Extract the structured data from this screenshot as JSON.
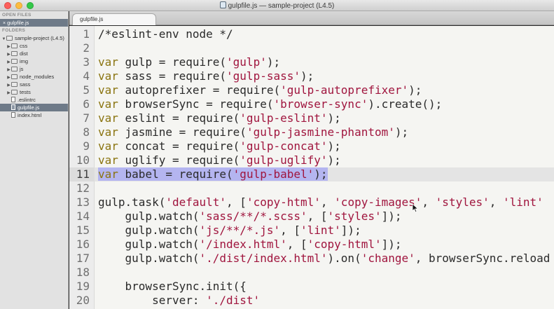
{
  "window": {
    "title": "gulpfile.js — sample-project (L4.5)"
  },
  "sidebar": {
    "open_files_header": "OPEN FILES",
    "open_files": [
      {
        "close": "×",
        "name": "gulpfile.js"
      }
    ],
    "folders_header": "FOLDERS",
    "tree": [
      {
        "arrow": "▼",
        "kind": "folder",
        "label": "sample-project (L4.5)",
        "depth": 0,
        "selected": false
      },
      {
        "arrow": "▶",
        "kind": "folder",
        "label": "css",
        "depth": 1,
        "selected": false
      },
      {
        "arrow": "▶",
        "kind": "folder",
        "label": "dist",
        "depth": 1,
        "selected": false
      },
      {
        "arrow": "▶",
        "kind": "folder",
        "label": "img",
        "depth": 1,
        "selected": false
      },
      {
        "arrow": "▶",
        "kind": "folder",
        "label": "js",
        "depth": 1,
        "selected": false
      },
      {
        "arrow": "▶",
        "kind": "folder",
        "label": "node_modules",
        "depth": 1,
        "selected": false
      },
      {
        "arrow": "▶",
        "kind": "folder",
        "label": "sass",
        "depth": 1,
        "selected": false
      },
      {
        "arrow": "▶",
        "kind": "folder",
        "label": "tests",
        "depth": 1,
        "selected": false
      },
      {
        "arrow": "",
        "kind": "file",
        "label": ".eslintrc",
        "depth": 1,
        "selected": false
      },
      {
        "arrow": "",
        "kind": "file",
        "label": "gulpfile.js",
        "depth": 1,
        "selected": true
      },
      {
        "arrow": "",
        "kind": "file",
        "label": "index.html",
        "depth": 1,
        "selected": false
      }
    ]
  },
  "tabs": [
    {
      "label": "gulpfile.js"
    }
  ],
  "editor": {
    "current_line": 11,
    "selected_line": 11,
    "lines": [
      {
        "n": "1",
        "tokens": [
          [
            "cm",
            "/*eslint-env node */"
          ]
        ]
      },
      {
        "n": "2",
        "tokens": []
      },
      {
        "n": "3",
        "tokens": [
          [
            "kw",
            "var"
          ],
          [
            "plain",
            " gulp = require("
          ],
          [
            "str",
            "'gulp'"
          ],
          [
            "plain",
            ");"
          ]
        ]
      },
      {
        "n": "4",
        "tokens": [
          [
            "kw",
            "var"
          ],
          [
            "plain",
            " sass = require("
          ],
          [
            "str",
            "'gulp-sass'"
          ],
          [
            "plain",
            ");"
          ]
        ]
      },
      {
        "n": "5",
        "tokens": [
          [
            "kw",
            "var"
          ],
          [
            "plain",
            " autoprefixer = require("
          ],
          [
            "str",
            "'gulp-autoprefixer'"
          ],
          [
            "plain",
            ");"
          ]
        ]
      },
      {
        "n": "6",
        "tokens": [
          [
            "kw",
            "var"
          ],
          [
            "plain",
            " browserSync = require("
          ],
          [
            "str",
            "'browser-sync'"
          ],
          [
            "plain",
            ").create();"
          ]
        ]
      },
      {
        "n": "7",
        "tokens": [
          [
            "kw",
            "var"
          ],
          [
            "plain",
            " eslint = require("
          ],
          [
            "str",
            "'gulp-eslint'"
          ],
          [
            "plain",
            ");"
          ]
        ]
      },
      {
        "n": "8",
        "tokens": [
          [
            "kw",
            "var"
          ],
          [
            "plain",
            " jasmine = require("
          ],
          [
            "str",
            "'gulp-jasmine-phantom'"
          ],
          [
            "plain",
            ");"
          ]
        ]
      },
      {
        "n": "9",
        "tokens": [
          [
            "kw",
            "var"
          ],
          [
            "plain",
            " concat = require("
          ],
          [
            "str",
            "'gulp-concat'"
          ],
          [
            "plain",
            ");"
          ]
        ]
      },
      {
        "n": "10",
        "tokens": [
          [
            "kw",
            "var"
          ],
          [
            "plain",
            " uglify = require("
          ],
          [
            "str",
            "'gulp-uglify'"
          ],
          [
            "plain",
            ");"
          ]
        ]
      },
      {
        "n": "11",
        "tokens": [
          [
            "kw",
            "var"
          ],
          [
            "plain",
            " babel = require("
          ],
          [
            "str",
            "'gulp-babel'"
          ],
          [
            "plain",
            ");"
          ]
        ]
      },
      {
        "n": "12",
        "tokens": []
      },
      {
        "n": "13",
        "tokens": [
          [
            "plain",
            "gulp.task("
          ],
          [
            "str",
            "'default'"
          ],
          [
            "plain",
            ", ["
          ],
          [
            "str",
            "'copy-html'"
          ],
          [
            "plain",
            ", "
          ],
          [
            "str",
            "'copy-images'"
          ],
          [
            "plain",
            ", "
          ],
          [
            "str",
            "'styles'"
          ],
          [
            "plain",
            ", "
          ],
          [
            "str",
            "'lint'"
          ]
        ]
      },
      {
        "n": "14",
        "tokens": [
          [
            "plain",
            "    gulp.watch("
          ],
          [
            "str",
            "'sass/**/*.scss'"
          ],
          [
            "plain",
            ", ["
          ],
          [
            "str",
            "'styles'"
          ],
          [
            "plain",
            "]);"
          ]
        ]
      },
      {
        "n": "15",
        "tokens": [
          [
            "plain",
            "    gulp.watch("
          ],
          [
            "str",
            "'js/**/*.js'"
          ],
          [
            "plain",
            ", ["
          ],
          [
            "str",
            "'lint'"
          ],
          [
            "plain",
            "]);"
          ]
        ]
      },
      {
        "n": "16",
        "tokens": [
          [
            "plain",
            "    gulp.watch("
          ],
          [
            "str",
            "'/index.html'"
          ],
          [
            "plain",
            ", ["
          ],
          [
            "str",
            "'copy-html'"
          ],
          [
            "plain",
            "]);"
          ]
        ]
      },
      {
        "n": "17",
        "tokens": [
          [
            "plain",
            "    gulp.watch("
          ],
          [
            "str",
            "'./dist/index.html'"
          ],
          [
            "plain",
            ").on("
          ],
          [
            "str",
            "'change'"
          ],
          [
            "plain",
            ", browserSync.reload"
          ]
        ]
      },
      {
        "n": "18",
        "tokens": []
      },
      {
        "n": "19",
        "tokens": [
          [
            "plain",
            "    browserSync.init({"
          ]
        ]
      },
      {
        "n": "20",
        "tokens": [
          [
            "plain",
            "        server: "
          ],
          [
            "str",
            "'./dist'"
          ]
        ]
      }
    ]
  },
  "colors": {
    "keyword": "#8a7410",
    "string": "#a0153e",
    "selection": "#b4b5f0",
    "sidebar_selected": "#6e7a88"
  }
}
